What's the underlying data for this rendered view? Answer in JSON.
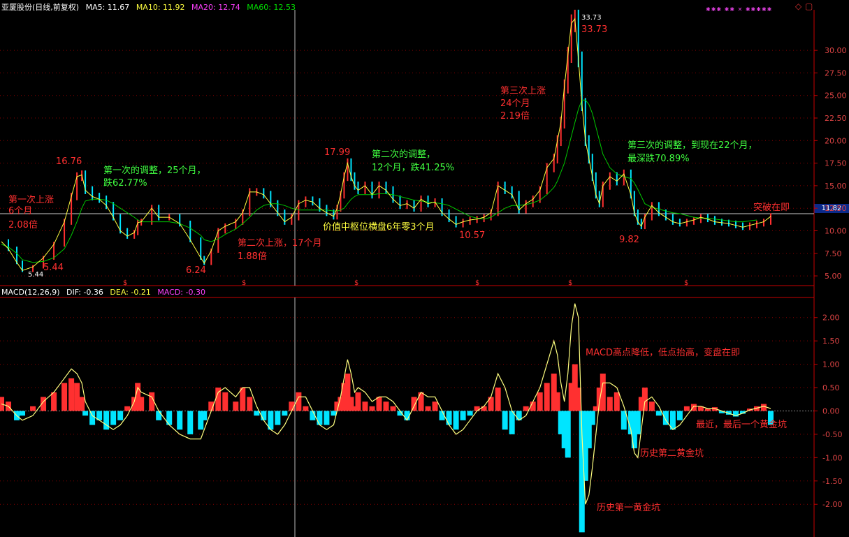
{
  "header": {
    "title": "亚厦股份(日线,前复权)",
    "ma5": "MA5: 11.67",
    "ma10": "MA10: 11.92",
    "ma20": "MA20: 12.74",
    "ma60": "MA60: 12.53",
    "macd_title": "MACD(12,26,9)",
    "dif": "DIF: -0.36",
    "dea": "DEA: -0.21",
    "macd": "MACD: -0.30",
    "current_price": "11.82",
    "marks": "✱✱✱ ✱✱ ✕ ✱✱✱✱✱"
  },
  "colors": {
    "up": "#ff3030",
    "down": "#00e5ff",
    "ma_yellow": "#ffff40",
    "ma_green": "#00c800",
    "magenta": "#ff40ff",
    "annot_red": "#ff3030",
    "annot_green": "#40ff40",
    "annot_yellow": "#ffff40",
    "axis": "#c80000"
  },
  "chart_data": [
    {
      "type": "line",
      "name": "price",
      "ylim": [
        4,
        34.5
      ],
      "y_ticks": [
        5.0,
        7.5,
        10.0,
        12.5,
        15.0,
        17.5,
        20.0,
        22.5,
        25.0,
        27.5,
        30.0
      ],
      "y_tick_labels": [
        "5.00",
        "7.50",
        "10.00",
        "12.50",
        "15.00",
        "17.50",
        "20.00",
        "22.50",
        "25.00",
        "27.50",
        "30.00"
      ],
      "x": [
        0,
        10,
        22,
        30,
        45,
        60,
        75,
        90,
        100,
        108,
        115,
        120,
        130,
        140,
        150,
        160,
        170,
        180,
        190,
        195,
        200,
        215,
        225,
        240,
        255,
        270,
        285,
        290,
        300,
        310,
        320,
        335,
        345,
        355,
        365,
        375,
        385,
        395,
        405,
        415,
        425,
        435,
        445,
        455,
        465,
        475,
        480,
        485,
        490,
        495,
        500,
        505,
        510,
        520,
        530,
        540,
        550,
        560,
        570,
        580,
        590,
        600,
        610,
        620,
        630,
        640,
        650,
        660,
        670,
        680,
        690,
        700,
        710,
        720,
        730,
        740,
        750,
        760,
        770,
        780,
        790,
        795,
        800,
        805,
        810,
        815,
        820,
        825,
        830,
        835,
        840,
        845,
        850,
        855,
        860,
        870,
        880,
        890,
        900,
        905,
        910,
        915,
        920,
        930,
        940,
        950,
        960,
        970,
        980,
        990,
        1000,
        1010,
        1020,
        1030,
        1040,
        1050,
        1060,
        1070,
        1080,
        1090,
        1100
      ],
      "close": [
        8.8,
        8.0,
        6.5,
        5.6,
        6.0,
        7.0,
        8.5,
        11.0,
        13.8,
        16.0,
        16.2,
        14.5,
        13.8,
        13.5,
        12.8,
        11.5,
        10.0,
        9.4,
        9.8,
        10.9,
        11.0,
        12.5,
        11.5,
        11.5,
        10.8,
        9.0,
        7.0,
        6.4,
        7.8,
        10.0,
        10.5,
        11.0,
        12.0,
        14.3,
        14.3,
        14.0,
        13.0,
        12.0,
        11.0,
        11.5,
        13.0,
        13.4,
        13.2,
        12.5,
        12.0,
        11.6,
        12.5,
        14.0,
        16.0,
        17.5,
        16.0,
        15.0,
        14.5,
        15.0,
        14.0,
        15.0,
        14.5,
        13.5,
        12.8,
        13.0,
        12.5,
        13.5,
        13.0,
        13.2,
        12.0,
        11.3,
        10.7,
        11.0,
        11.2,
        11.3,
        11.5,
        12.0,
        15.0,
        14.5,
        14.0,
        12.3,
        13.0,
        13.5,
        14.5,
        17.0,
        18.0,
        20.0,
        22.0,
        26.0,
        29.5,
        33.0,
        33.5,
        29.0,
        24.0,
        20.0,
        18.0,
        16.0,
        14.0,
        13.0,
        15.0,
        16.0,
        15.5,
        16.3,
        14.0,
        12.0,
        11.0,
        10.5,
        11.5,
        12.8,
        12.0,
        11.5,
        11.0,
        10.8,
        11.0,
        11.2,
        11.5,
        11.3,
        11.0,
        10.9,
        10.8,
        10.6,
        10.4,
        10.6,
        10.8,
        11.0,
        11.6
      ],
      "ma60": [
        8.5,
        8.2,
        7.5,
        6.8,
        6.5,
        6.6,
        7.0,
        8.0,
        9.5,
        11.0,
        12.5,
        13.3,
        13.5,
        13.5,
        13.4,
        13.0,
        12.5,
        12.0,
        11.5,
        11.2,
        11.0,
        11.0,
        11.0,
        11.0,
        10.8,
        10.3,
        9.5,
        9.0,
        8.8,
        9.1,
        9.6,
        10.2,
        10.8,
        11.5,
        12.3,
        12.8,
        13.0,
        13.0,
        12.8,
        12.5,
        12.3,
        12.3,
        12.3,
        12.3,
        12.3,
        12.2,
        12.2,
        12.3,
        12.5,
        13.0,
        13.5,
        13.8,
        14.0,
        14.0,
        14.0,
        14.1,
        14.1,
        14.0,
        13.8,
        13.6,
        13.4,
        13.3,
        13.2,
        13.1,
        13.0,
        12.8,
        12.4,
        12.0,
        11.6,
        11.4,
        11.3,
        11.5,
        12.0,
        12.5,
        12.8,
        12.8,
        12.9,
        13.1,
        13.4,
        14.0,
        14.8,
        15.5,
        16.5,
        17.5,
        19.0,
        20.5,
        22.0,
        23.5,
        24.5,
        24.5,
        24.0,
        23.0,
        21.5,
        20.0,
        18.5,
        17.0,
        16.3,
        16.0,
        15.8,
        15.3,
        14.6,
        13.8,
        13.0,
        12.6,
        12.4,
        12.2,
        12.0,
        11.9,
        11.7,
        11.5,
        11.4,
        11.4,
        11.3,
        11.2,
        11.1,
        11.0,
        11.0,
        11.1,
        11.2
      ]
    },
    {
      "type": "bar",
      "name": "MACD",
      "ylim": [
        -2.7,
        2.4
      ],
      "y_ticks": [
        2.0,
        1.5,
        1.0,
        0.5,
        0.0,
        -0.5,
        -1.0,
        -1.5,
        -2.0
      ],
      "y_tick_labels": [
        "2.00",
        "1.50",
        "1.00",
        "0.50",
        "0.00",
        "-0.50",
        "-1.00",
        "-1.50",
        "-2.00"
      ],
      "x": [
        0,
        10,
        22,
        30,
        45,
        60,
        75,
        90,
        100,
        108,
        115,
        120,
        130,
        140,
        150,
        160,
        170,
        180,
        190,
        195,
        200,
        215,
        225,
        240,
        255,
        270,
        285,
        290,
        300,
        310,
        320,
        335,
        345,
        355,
        365,
        375,
        385,
        395,
        405,
        415,
        425,
        435,
        445,
        455,
        465,
        475,
        480,
        485,
        490,
        495,
        500,
        505,
        510,
        520,
        530,
        540,
        550,
        560,
        570,
        580,
        590,
        600,
        610,
        620,
        630,
        640,
        650,
        660,
        670,
        680,
        690,
        700,
        710,
        720,
        730,
        740,
        750,
        760,
        770,
        780,
        790,
        795,
        800,
        805,
        810,
        815,
        820,
        825,
        830,
        835,
        840,
        845,
        850,
        855,
        860,
        870,
        880,
        890,
        900,
        905,
        910,
        915,
        920,
        930,
        940,
        950,
        960,
        970,
        980,
        990,
        1000,
        1010,
        1020,
        1030,
        1040,
        1050,
        1060,
        1070,
        1080,
        1090,
        1100
      ],
      "macd": [
        0.3,
        0.2,
        -0.2,
        -0.1,
        0.1,
        0.3,
        0.4,
        0.6,
        0.7,
        0.6,
        0.3,
        -0.1,
        -0.3,
        -0.2,
        -0.4,
        -0.3,
        -0.2,
        0.1,
        0.3,
        0.6,
        0.3,
        0.4,
        -0.2,
        -0.3,
        -0.4,
        -0.5,
        -0.4,
        -0.2,
        0.2,
        0.5,
        0.4,
        0.2,
        0.5,
        0.3,
        -0.1,
        -0.2,
        -0.4,
        -0.3,
        -0.1,
        0.2,
        0.4,
        0.1,
        -0.2,
        -0.3,
        -0.3,
        -0.1,
        0.2,
        0.3,
        0.6,
        0.8,
        0.3,
        0.1,
        0.4,
        0.2,
        0.1,
        0.3,
        0.2,
        0.1,
        -0.1,
        -0.2,
        0.3,
        0.4,
        0.1,
        0.2,
        -0.2,
        -0.3,
        -0.4,
        -0.2,
        -0.1,
        0.1,
        0.1,
        0.3,
        0.5,
        -0.4,
        -0.5,
        -0.2,
        0.1,
        0.2,
        0.4,
        0.6,
        0.8,
        0.4,
        -0.5,
        -0.8,
        -1.0,
        0.6,
        1.0,
        0.5,
        -2.6,
        -1.5,
        -0.8,
        -0.3,
        0.1,
        0.5,
        0.8,
        0.3,
        0.4,
        -0.4,
        -0.5,
        -0.8,
        -0.5,
        0.3,
        0.5,
        0.2,
        -0.1,
        -0.3,
        -0.4,
        -0.2,
        0.1,
        0.15,
        0.1,
        0.05,
        0.08,
        -0.05,
        -0.08,
        -0.12,
        -0.06,
        0.05,
        0.1,
        0.15,
        -0.3
      ],
      "dif": [
        0.15,
        0.1,
        -0.1,
        -0.2,
        -0.1,
        0.2,
        0.4,
        0.7,
        0.9,
        0.8,
        0.6,
        0.2,
        -0.1,
        -0.2,
        -0.3,
        -0.4,
        -0.3,
        -0.1,
        0.2,
        0.5,
        0.4,
        0.3,
        0.0,
        -0.3,
        -0.5,
        -0.6,
        -0.6,
        -0.4,
        0.0,
        0.4,
        0.5,
        0.3,
        0.5,
        0.5,
        0.1,
        -0.2,
        -0.4,
        -0.5,
        -0.3,
        0.0,
        0.3,
        0.3,
        0.0,
        -0.3,
        -0.4,
        -0.3,
        0.0,
        0.3,
        0.7,
        1.1,
        0.8,
        0.4,
        0.5,
        0.4,
        0.2,
        0.3,
        0.3,
        0.2,
        0.0,
        -0.2,
        0.1,
        0.4,
        0.3,
        0.3,
        0.0,
        -0.3,
        -0.5,
        -0.4,
        -0.2,
        0.0,
        0.1,
        0.3,
        0.8,
        0.5,
        0.0,
        -0.2,
        -0.1,
        0.2,
        0.5,
        1.0,
        1.5,
        1.2,
        0.6,
        0.2,
        0.8,
        1.8,
        2.3,
        2.0,
        -0.5,
        -2.0,
        -1.8,
        -1.2,
        -0.5,
        0.2,
        0.6,
        0.6,
        0.5,
        0.1,
        -0.4,
        -0.9,
        -1.0,
        -0.4,
        0.2,
        0.3,
        0.1,
        -0.2,
        -0.4,
        -0.3,
        -0.1,
        0.1,
        0.1,
        0.05,
        0.05,
        0.0,
        -0.05,
        -0.1,
        -0.05,
        0.02,
        0.06,
        0.1,
        0.05
      ]
    }
  ],
  "annotations": {
    "p16_76": "16.76",
    "p5_44": "5.44",
    "p5_44_low": "5.44",
    "p6_24": "6.24",
    "p17_99": "17.99",
    "p10_57": "10.57",
    "p33_73": "33.73",
    "p33_73_small": "33.73",
    "p9_82": "9.82",
    "rise1_a": "第一次上涨",
    "rise1_b": "6个月",
    "rise1_c": "2.08倍",
    "adj1_a": "第一次的调整，25个月，",
    "adj1_b": "跌62.77%",
    "rise2_a": "第二次上涨，17个月",
    "rise2_b": "1.88倍",
    "adj2_a": "第二次的调整，",
    "adj2_b": "12个月，跌41.25%",
    "consol": "价值中枢位横盘6年零3个月",
    "rise3_a": "第三次上涨",
    "rise3_b": "24个月",
    "rise3_c": "2.19倍",
    "adj3_a": "第三次的调整，到现在22个月，",
    "adj3_b": "最深跌70.89%",
    "breakout": "突破在即",
    "macd_note": "MACD高点降低，低点抬高，变盘在即",
    "recent_pit": "最近，最后一个黄金坑",
    "pit2": "历史第二黄金坑",
    "pit1": "历史第一黄金坑"
  }
}
